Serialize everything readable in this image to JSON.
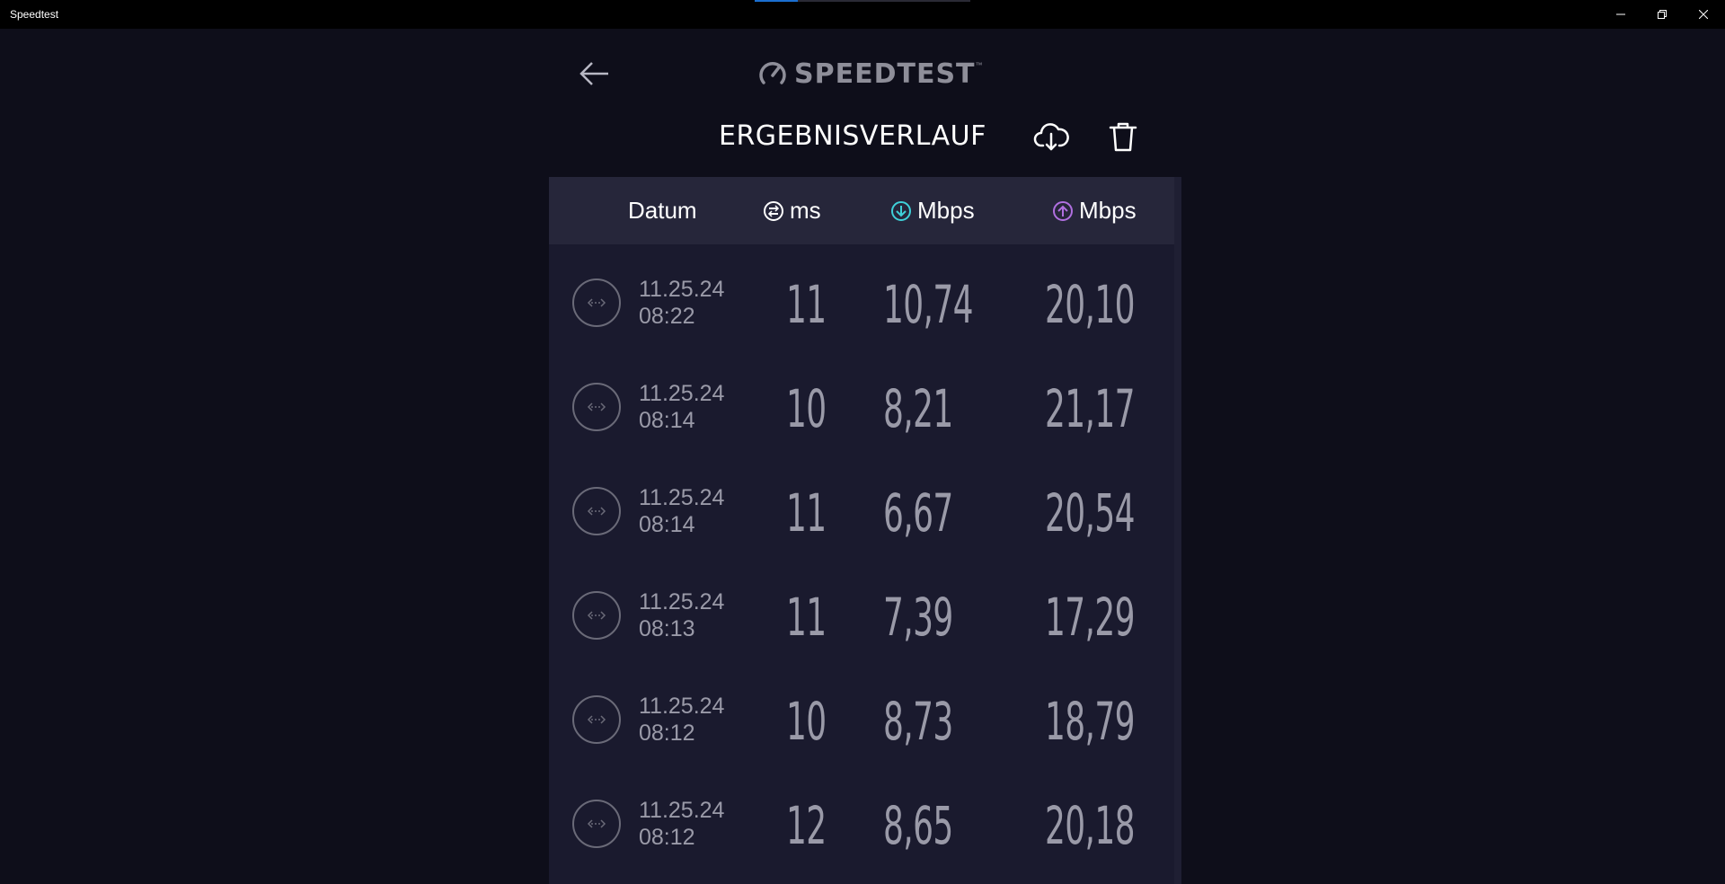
{
  "window": {
    "title": "Speedtest"
  },
  "header": {
    "logo_text": "SPEEDTEST",
    "page_title": "ERGEBNISVERLAUF"
  },
  "table": {
    "columns": {
      "date": "Datum",
      "ping": "ms",
      "download": "Mbps",
      "upload": "Mbps"
    },
    "rows": [
      {
        "date": "11.25.24",
        "time": "08:22",
        "ping": "11",
        "download": "10,74",
        "upload": "20,10"
      },
      {
        "date": "11.25.24",
        "time": "08:14",
        "ping": "10",
        "download": "8,21",
        "upload": "21,17"
      },
      {
        "date": "11.25.24",
        "time": "08:14",
        "ping": "11",
        "download": "6,67",
        "upload": "20,54"
      },
      {
        "date": "11.25.24",
        "time": "08:13",
        "ping": "11",
        "download": "7,39",
        "upload": "17,29"
      },
      {
        "date": "11.25.24",
        "time": "08:12",
        "ping": "10",
        "download": "8,73",
        "upload": "18,79"
      },
      {
        "date": "11.25.24",
        "time": "08:12",
        "ping": "12",
        "download": "8,65",
        "upload": "20,18"
      }
    ]
  },
  "colors": {
    "background": "#0e0e1a",
    "table_bg": "#1a1a2e",
    "header_bg": "#26263a",
    "download_accent": "#3fd0d8",
    "upload_accent": "#b06fe0",
    "muted_text": "#9a9aa8"
  },
  "icons": {
    "back": "arrow-left-icon",
    "export": "cloud-download-icon",
    "delete": "trash-icon",
    "ping": "ping-icon",
    "download": "download-arrow-icon",
    "upload": "upload-arrow-icon",
    "connection": "connection-icon"
  }
}
